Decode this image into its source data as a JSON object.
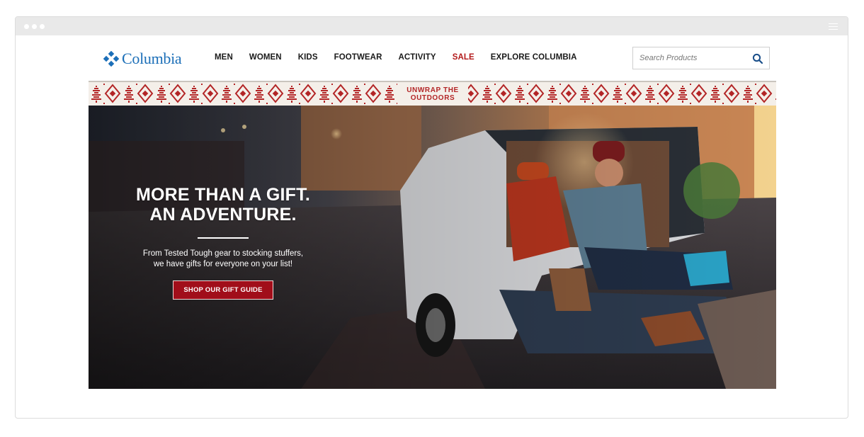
{
  "brand": {
    "name": "Columbia",
    "color": "#1c6fb8",
    "logo_icon": "columbia-diamond-icon"
  },
  "nav": {
    "items": [
      {
        "label": "MEN"
      },
      {
        "label": "WOMEN"
      },
      {
        "label": "KIDS"
      },
      {
        "label": "FOOTWEAR"
      },
      {
        "label": "ACTIVITY"
      },
      {
        "label": "SALE",
        "highlight": true
      },
      {
        "label": "EXPLORE COLUMBIA"
      }
    ],
    "sale_color": "#b3191a"
  },
  "search": {
    "placeholder": "Search Products",
    "value": "",
    "icon": "search-icon"
  },
  "banner": {
    "line1": "UNWRAP THE",
    "line2": "OUTDOORS",
    "accent": "#b32526"
  },
  "hero": {
    "title_line1": "MORE THAN A GIFT.",
    "title_line2": "AN ADVENTURE.",
    "subtitle_line1": "From Tested Tough gear to stocking stuffers,",
    "subtitle_line2": "we have gifts for everyone on your list!",
    "cta_label": "SHOP OUR GIFT GUIDE",
    "cta_color": "#a10e1a"
  }
}
